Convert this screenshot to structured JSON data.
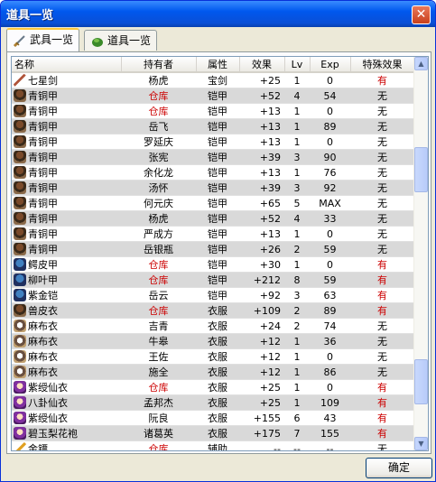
{
  "window": {
    "title": "道具一览",
    "close_glyph": "✕"
  },
  "tabs": [
    {
      "label": "武具一览",
      "icon": "sword-icon",
      "active": true
    },
    {
      "label": "道具一览",
      "icon": "bag-icon",
      "active": false
    }
  ],
  "table": {
    "columns": [
      "名称",
      "持有者",
      "属性",
      "效果",
      "Lv",
      "Exp",
      "特殊效果"
    ],
    "rows": [
      {
        "icon": "sword-icon",
        "name": "七星剑",
        "owner": "杨虎",
        "owner_red": false,
        "type": "宝剑",
        "effect": "+25",
        "lv": "1",
        "exp": "0",
        "special": "有",
        "special_red": true
      },
      {
        "icon": "armor-icon",
        "name": "青铜甲",
        "owner": "仓库",
        "owner_red": true,
        "type": "铠甲",
        "effect": "+52",
        "lv": "4",
        "exp": "54",
        "special": "无",
        "special_red": false
      },
      {
        "icon": "armor-icon",
        "name": "青铜甲",
        "owner": "仓库",
        "owner_red": true,
        "type": "铠甲",
        "effect": "+13",
        "lv": "1",
        "exp": "0",
        "special": "无",
        "special_red": false
      },
      {
        "icon": "armor-icon",
        "name": "青铜甲",
        "owner": "岳飞",
        "owner_red": false,
        "type": "铠甲",
        "effect": "+13",
        "lv": "1",
        "exp": "89",
        "special": "无",
        "special_red": false
      },
      {
        "icon": "armor-icon",
        "name": "青铜甲",
        "owner": "罗延庆",
        "owner_red": false,
        "type": "铠甲",
        "effect": "+13",
        "lv": "1",
        "exp": "0",
        "special": "无",
        "special_red": false
      },
      {
        "icon": "armor-icon",
        "name": "青铜甲",
        "owner": "张宪",
        "owner_red": false,
        "type": "铠甲",
        "effect": "+39",
        "lv": "3",
        "exp": "90",
        "special": "无",
        "special_red": false
      },
      {
        "icon": "armor-icon",
        "name": "青铜甲",
        "owner": "余化龙",
        "owner_red": false,
        "type": "铠甲",
        "effect": "+13",
        "lv": "1",
        "exp": "76",
        "special": "无",
        "special_red": false
      },
      {
        "icon": "armor-icon",
        "name": "青铜甲",
        "owner": "汤怀",
        "owner_red": false,
        "type": "铠甲",
        "effect": "+39",
        "lv": "3",
        "exp": "92",
        "special": "无",
        "special_red": false
      },
      {
        "icon": "armor-icon",
        "name": "青铜甲",
        "owner": "何元庆",
        "owner_red": false,
        "type": "铠甲",
        "effect": "+65",
        "lv": "5",
        "exp": "MAX",
        "special": "无",
        "special_red": false
      },
      {
        "icon": "armor-icon",
        "name": "青铜甲",
        "owner": "杨虎",
        "owner_red": false,
        "type": "铠甲",
        "effect": "+52",
        "lv": "4",
        "exp": "33",
        "special": "无",
        "special_red": false
      },
      {
        "icon": "armor-icon",
        "name": "青铜甲",
        "owner": "严成方",
        "owner_red": false,
        "type": "铠甲",
        "effect": "+13",
        "lv": "1",
        "exp": "0",
        "special": "无",
        "special_red": false
      },
      {
        "icon": "armor-icon",
        "name": "青铜甲",
        "owner": "岳银瓶",
        "owner_red": false,
        "type": "铠甲",
        "effect": "+26",
        "lv": "2",
        "exp": "59",
        "special": "无",
        "special_red": false
      },
      {
        "icon": "scale-icon",
        "name": "鳄皮甲",
        "owner": "仓库",
        "owner_red": true,
        "type": "铠甲",
        "effect": "+30",
        "lv": "1",
        "exp": "0",
        "special": "有",
        "special_red": true
      },
      {
        "icon": "scale-icon",
        "name": "柳叶甲",
        "owner": "仓库",
        "owner_red": true,
        "type": "铠甲",
        "effect": "+212",
        "lv": "8",
        "exp": "59",
        "special": "有",
        "special_red": true
      },
      {
        "icon": "scale-icon",
        "name": "紫金铠",
        "owner": "岳云",
        "owner_red": false,
        "type": "铠甲",
        "effect": "+92",
        "lv": "3",
        "exp": "63",
        "special": "有",
        "special_red": true
      },
      {
        "icon": "armor-icon",
        "name": "兽皮衣",
        "owner": "仓库",
        "owner_red": true,
        "type": "衣服",
        "effect": "+109",
        "lv": "2",
        "exp": "89",
        "special": "有",
        "special_red": true
      },
      {
        "icon": "cloth-icon",
        "name": "麻布衣",
        "owner": "吉青",
        "owner_red": false,
        "type": "衣服",
        "effect": "+24",
        "lv": "2",
        "exp": "74",
        "special": "无",
        "special_red": false
      },
      {
        "icon": "cloth-icon",
        "name": "麻布衣",
        "owner": "牛皋",
        "owner_red": false,
        "type": "衣服",
        "effect": "+12",
        "lv": "1",
        "exp": "36",
        "special": "无",
        "special_red": false
      },
      {
        "icon": "cloth-icon",
        "name": "麻布衣",
        "owner": "王佐",
        "owner_red": false,
        "type": "衣服",
        "effect": "+12",
        "lv": "1",
        "exp": "0",
        "special": "无",
        "special_red": false
      },
      {
        "icon": "cloth-icon",
        "name": "麻布衣",
        "owner": "施全",
        "owner_red": false,
        "type": "衣服",
        "effect": "+12",
        "lv": "1",
        "exp": "86",
        "special": "无",
        "special_red": false
      },
      {
        "icon": "robe-icon",
        "name": "紫绶仙衣",
        "owner": "仓库",
        "owner_red": true,
        "type": "衣服",
        "effect": "+25",
        "lv": "1",
        "exp": "0",
        "special": "有",
        "special_red": true
      },
      {
        "icon": "robe-icon",
        "name": "八卦仙衣",
        "owner": "孟邦杰",
        "owner_red": false,
        "type": "衣服",
        "effect": "+25",
        "lv": "1",
        "exp": "109",
        "special": "有",
        "special_red": true
      },
      {
        "icon": "robe-icon",
        "name": "紫绶仙衣",
        "owner": "阮良",
        "owner_red": false,
        "type": "衣服",
        "effect": "+155",
        "lv": "6",
        "exp": "43",
        "special": "有",
        "special_red": true
      },
      {
        "icon": "robe-icon",
        "name": "碧玉梨花袍",
        "owner": "诸葛英",
        "owner_red": false,
        "type": "衣服",
        "effect": "+175",
        "lv": "7",
        "exp": "155",
        "special": "有",
        "special_red": true
      },
      {
        "icon": "dart-icon",
        "name": "金镖",
        "owner": "仓库",
        "owner_red": true,
        "type": "辅助",
        "effect": "--",
        "lv": "--",
        "exp": "--",
        "special": "无",
        "special_red": false
      }
    ]
  },
  "scrollbar": {
    "up_glyph": "▲",
    "down_glyph": "▼"
  },
  "ok_button": {
    "label": "确定"
  }
}
